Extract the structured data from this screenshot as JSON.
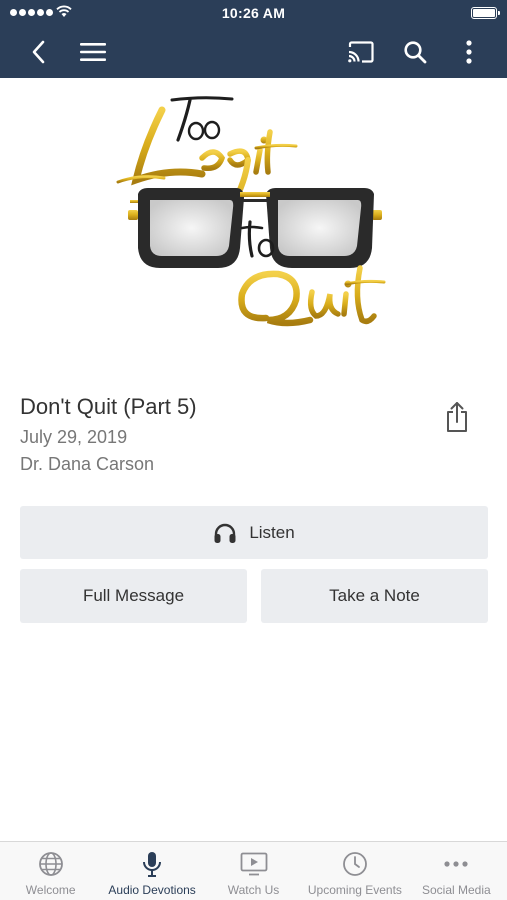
{
  "status_bar": {
    "time": "10:26 AM"
  },
  "navbar": {
    "back_icon": "chevron-left-icon",
    "menu_icon": "hamburger-menu-icon",
    "cast_icon": "cast-icon",
    "search_icon": "search-icon",
    "more_icon": "vertical-ellipsis-icon"
  },
  "artwork": {
    "logo_text_lines": [
      "Too",
      "Legit",
      "to",
      "Quit"
    ],
    "colors": {
      "gold": "#d9ad1b",
      "frame": "#2a2a2a"
    }
  },
  "message": {
    "title": "Don't Quit (Part 5)",
    "date": "July 29, 2019",
    "speaker": "Dr. Dana Carson"
  },
  "actions": {
    "listen_label": "Listen",
    "full_message_label": "Full Message",
    "take_note_label": "Take a Note"
  },
  "tabs": [
    {
      "label": "Welcome",
      "icon": "globe-icon",
      "active": false
    },
    {
      "label": "Audio Devotions",
      "icon": "microphone-icon",
      "active": true
    },
    {
      "label": "Watch Us",
      "icon": "video-play-icon",
      "active": false
    },
    {
      "label": "Upcoming Events",
      "icon": "clock-icon",
      "active": false
    },
    {
      "label": "Social Media",
      "icon": "more-dots-icon",
      "active": false
    }
  ],
  "colors": {
    "header_bg": "#2b3e58",
    "button_bg": "#ebedf0",
    "tab_active": "#2b3e58",
    "tab_inactive": "#8e8e93"
  }
}
